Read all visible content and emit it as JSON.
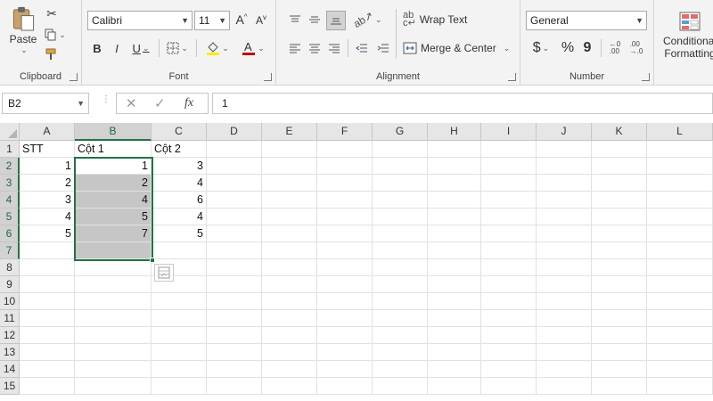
{
  "ribbon": {
    "clipboard": {
      "paste_label": "Paste",
      "group_label": "Clipboard"
    },
    "font": {
      "font_name": "Calibri",
      "font_size": "11",
      "bold": "B",
      "italic": "I",
      "underline": "U",
      "group_label": "Font"
    },
    "alignment": {
      "wrap_text": "Wrap Text",
      "merge_center": "Merge & Center",
      "group_label": "Alignment"
    },
    "number": {
      "format": "General",
      "currency": "$",
      "percent": "%",
      "comma": "9",
      "group_label": "Number"
    },
    "styles": {
      "cond_line1": "Conditional",
      "cond_line2": "Formatting"
    }
  },
  "formula_bar": {
    "name_box": "B2",
    "fx": "fx",
    "value": "1"
  },
  "grid": {
    "columns": [
      "A",
      "B",
      "C",
      "D",
      "E",
      "F",
      "G",
      "H",
      "I",
      "J",
      "K",
      "L"
    ],
    "rows": [
      "1",
      "2",
      "3",
      "4",
      "5",
      "6",
      "7",
      "8",
      "9",
      "10",
      "11",
      "12",
      "13",
      "14",
      "15"
    ],
    "cells": {
      "A1": "STT",
      "B1": "Cột 1",
      "C1": "Cột 2",
      "A2": "1",
      "B2": "1",
      "C2": "3",
      "A3": "2",
      "B3": "2",
      "C3": "4",
      "A4": "3",
      "B4": "4",
      "C4": "6",
      "A5": "4",
      "B5": "5",
      "C5": "4",
      "A6": "5",
      "B6": "7",
      "C6": "5"
    },
    "selected_column": "B",
    "selected_rows": [
      "2",
      "3",
      "4",
      "5",
      "6",
      "7"
    ]
  },
  "colors": {
    "accent": "#217346",
    "font_color": "#c00000",
    "highlight": "#ffeb00"
  }
}
